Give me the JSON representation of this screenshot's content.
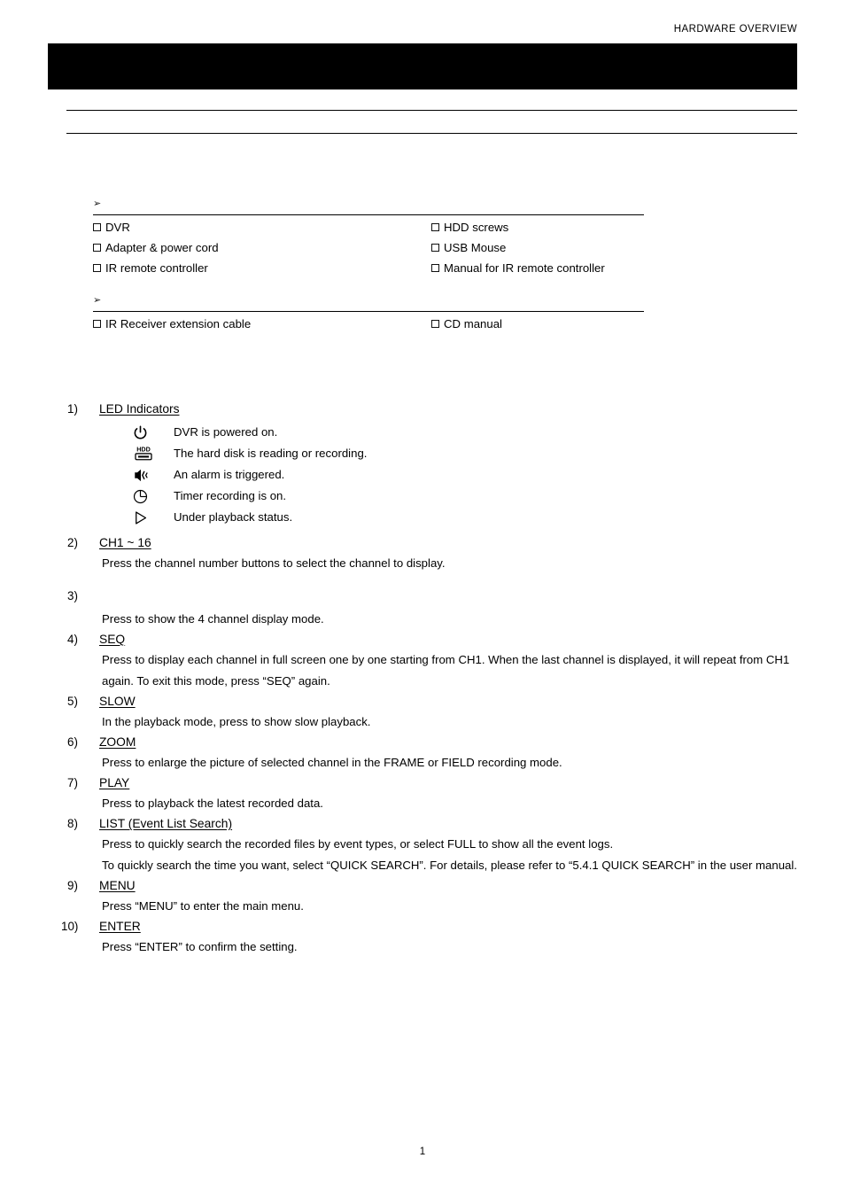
{
  "page": {
    "running_header": "HARDWARE OVERVIEW",
    "chapter_bar_title": "",
    "page_number": "1"
  },
  "packing": {
    "standard": {
      "bullet": "➢",
      "heading": "",
      "rows": [
        {
          "left": "DVR",
          "right": "HDD screws"
        },
        {
          "left": "Adapter & power cord",
          "right": "USB Mouse"
        },
        {
          "left": "IR remote controller",
          "right": "Manual for IR remote controller"
        }
      ]
    },
    "optional": {
      "bullet": "➢",
      "heading": "",
      "rows": [
        {
          "left": "IR Receiver extension cable",
          "right": "CD manual"
        }
      ]
    }
  },
  "items": [
    {
      "num": "1)",
      "title": "LED Indicators",
      "leds": [
        {
          "icon": "power-icon",
          "text": "DVR is powered on."
        },
        {
          "icon": "hdd-icon",
          "text": "The hard disk is reading or recording."
        },
        {
          "icon": "alarm-icon",
          "text": "An alarm is triggered."
        },
        {
          "icon": "timer-clock-icon",
          "text": "Timer recording is on."
        },
        {
          "icon": "play-icon",
          "text": "Under playback status."
        }
      ]
    },
    {
      "num": "2)",
      "title": "CH1 ~ 16",
      "body": [
        "Press the channel number buttons to select the channel to display."
      ]
    },
    {
      "num": "3)",
      "title_icon": "quad-display-icon",
      "body": [
        "Press to show the 4 channel display mode."
      ]
    },
    {
      "num": "4)",
      "title": "SEQ",
      "body": [
        "Press to display each channel in full screen one by one starting from CH1. When the last channel is displayed, it will repeat from CH1 again. To exit this mode, press “SEQ” again."
      ]
    },
    {
      "num": "5)",
      "title": "SLOW",
      "body": [
        "In the playback mode, press to show slow playback."
      ]
    },
    {
      "num": "6)",
      "title": "ZOOM",
      "body": [
        "Press to enlarge the picture of selected channel in the FRAME or FIELD recording mode."
      ]
    },
    {
      "num": "7)",
      "title": "PLAY",
      "body": [
        "Press to playback the latest recorded data."
      ]
    },
    {
      "num": "8)",
      "title": "LIST (Event List Search)",
      "body": [
        "Press to quickly search the recorded files by event types, or select FULL to show all the event logs.",
        "To quickly search the time you want, select “QUICK SEARCH”. For details, please refer to “5.4.1 QUICK SEARCH” in the user manual."
      ]
    },
    {
      "num": "9)",
      "title": "MENU",
      "body": [
        "Press “MENU” to enter the main menu."
      ]
    },
    {
      "num": "10)",
      "title": "ENTER",
      "body": [
        "Press “ENTER” to confirm the setting."
      ]
    }
  ]
}
